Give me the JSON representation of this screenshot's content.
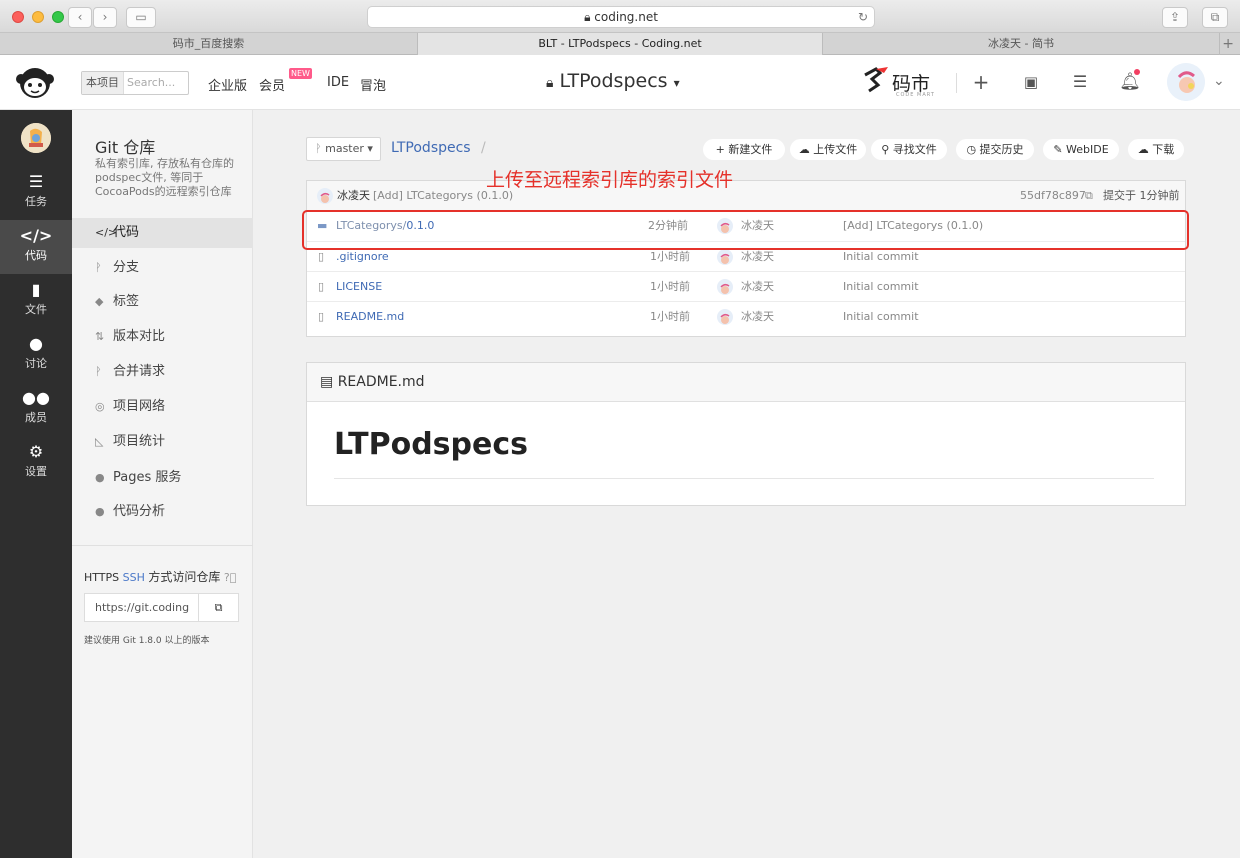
{
  "browser": {
    "url": "coding.net",
    "tabs": [
      "码市_百度搜索",
      "BLT - LTPodspecs - Coding.net",
      "冰凌天 - 简书"
    ],
    "active_tab_index": 1
  },
  "header": {
    "search_scope": "本项目",
    "search_placeholder": "Search...",
    "nav": [
      "企业版",
      "会员",
      "IDE",
      "冒泡"
    ],
    "new_badge": "NEW",
    "project_title": "LTPodspecs",
    "brand": "码市",
    "brand_sub": "CODE MART"
  },
  "darkbar": {
    "items": [
      {
        "label": "任务",
        "icon": "tasks-icon"
      },
      {
        "label": "代码",
        "icon": "code-icon"
      },
      {
        "label": "文件",
        "icon": "file-icon"
      },
      {
        "label": "讨论",
        "icon": "discussion-icon"
      },
      {
        "label": "成员",
        "icon": "members-icon"
      },
      {
        "label": "设置",
        "icon": "settings-icon"
      }
    ],
    "active_index": 1
  },
  "sidebar": {
    "title": "Git 仓库",
    "description": "私有索引库, 存放私有仓库的podspec文件, 等同于CocoaPods的远程索引仓库",
    "items": [
      {
        "label": "代码",
        "glyph": "</>"
      },
      {
        "label": "分支",
        "glyph": "ᚹ"
      },
      {
        "label": "标签",
        "glyph": "◆"
      },
      {
        "label": "版本对比",
        "glyph": "⇅"
      },
      {
        "label": "合并请求",
        "glyph": "ᚹ"
      },
      {
        "label": "项目网络",
        "glyph": "◎"
      },
      {
        "label": "项目统计",
        "glyph": "◺"
      },
      {
        "label": "Pages 服务",
        "glyph": "●"
      },
      {
        "label": "代码分析",
        "glyph": "●"
      }
    ],
    "active_index": 0,
    "clone": {
      "https": "HTTPS",
      "ssh": "SSH",
      "title_suffix": "方式访问仓库",
      "url": "https://git.coding",
      "note": "建议使用 Git 1.8.0 以上的版本"
    }
  },
  "repo": {
    "branch": "master",
    "name": "LTPodspecs",
    "actions": [
      "新建文件",
      "上传文件",
      "寻找文件",
      "提交历史",
      "WebIDE",
      "下载"
    ],
    "last_commit": {
      "author": "冰凌天",
      "message": "[Add] LTCategorys (0.1.0)",
      "hash": "55df78c897",
      "time": "提交于 1分钟前"
    },
    "files": [
      {
        "dir": "LTCategorys/",
        "name": "0.1.0",
        "type": "folder",
        "time": "2分钟前",
        "author": "冰凌天",
        "message": "[Add] LTCategorys (0.1.0)"
      },
      {
        "dir": "",
        "name": ".gitignore",
        "type": "file",
        "time": "1小时前",
        "author": "冰凌天",
        "message": "Initial commit"
      },
      {
        "dir": "",
        "name": "LICENSE",
        "type": "file",
        "time": "1小时前",
        "author": "冰凌天",
        "message": "Initial commit"
      },
      {
        "dir": "",
        "name": "README.md",
        "type": "file",
        "time": "1小时前",
        "author": "冰凌天",
        "message": "Initial commit"
      }
    ]
  },
  "annotation": {
    "text": "上传至远程索引库的索引文件",
    "color": "#e5312a"
  },
  "readme": {
    "filename": "README.md",
    "heading": "LTPodspecs"
  },
  "colors": {
    "link": "#3f6ab4",
    "darkbar": "#2e2e2e",
    "badge": "#ff5a8a"
  }
}
